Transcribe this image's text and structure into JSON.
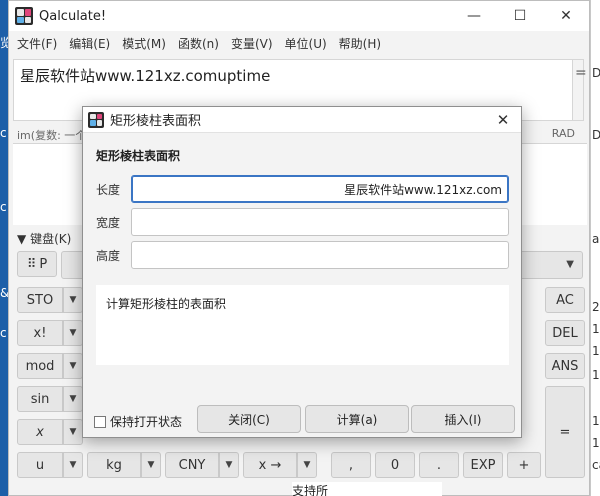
{
  "app": {
    "title": "Qalculate!"
  },
  "window_buttons": {
    "minimize": "—",
    "maximize": "☐",
    "close": "✕"
  },
  "menu": [
    "文件(F)",
    "编辑(E)",
    "模式(M)",
    "函数(n)",
    "变量(V)",
    "单位(U)",
    "帮助(H)"
  ],
  "expression": {
    "text": "星辰软件站www.121xz.comuptime",
    "equals": "="
  },
  "status": {
    "left": "im(复数: 一个",
    "right": "RAD"
  },
  "keypad": {
    "toggle_label": "键盘(K)",
    "grid_button": "P",
    "rows": [
      [
        "STO",
        "AC"
      ],
      [
        "x!",
        "DEL"
      ],
      [
        "mod",
        "ANS"
      ],
      [
        "sin",
        "="
      ],
      [
        "x",
        "="
      ],
      [
        "u",
        "kg",
        "CNY",
        "x →",
        ",",
        "0",
        ".",
        "EXP",
        "+"
      ]
    ]
  },
  "desktop": {
    "left_chars": [
      "览",
      "c",
      "c",
      "&",
      "c"
    ],
    "right_chars": [
      "D",
      "D",
      "a",
      "2",
      "1",
      "1",
      "1",
      "1",
      "1",
      "ca"
    ],
    "bottom_text": "支持所"
  },
  "dialog": {
    "title": "矩形棱柱表面积",
    "close_icon": "✕",
    "heading": "矩形棱柱表面积",
    "fields": [
      {
        "label": "长度",
        "value": "星辰软件站www.121xz.com"
      },
      {
        "label": "宽度",
        "value": ""
      },
      {
        "label": "高度",
        "value": ""
      }
    ],
    "description": "计算矩形棱柱的表面积",
    "keep_open_label": "保持打开状态",
    "buttons": {
      "close": "关闭(C)",
      "calculate": "计算(a)",
      "insert": "插入(I)"
    }
  },
  "colors": {
    "accent": "#3a75c4",
    "desktop": "#1d5fa8"
  }
}
